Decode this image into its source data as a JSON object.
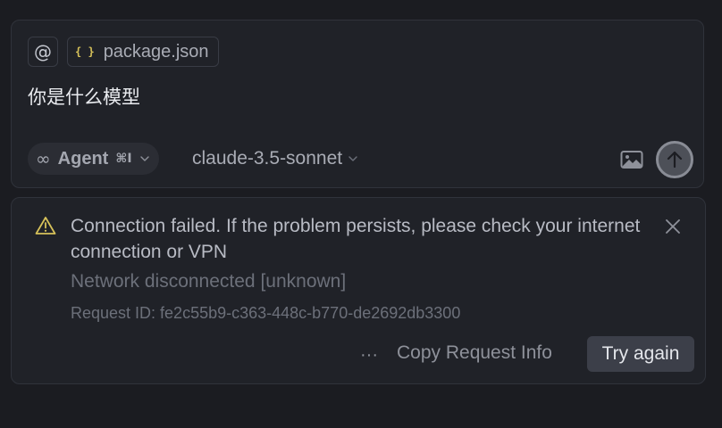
{
  "composer": {
    "mention_symbol": "@",
    "context_file": {
      "icon": "json-braces-icon",
      "icon_glyph": "{ }",
      "name": "package.json"
    },
    "prompt": "你是什么模型",
    "mode": {
      "icon": "infinity-icon",
      "icon_glyph": "∞",
      "label": "Agent",
      "shortcut": "⌘I"
    },
    "model": "claude-3.5-sonnet",
    "image_button_icon": "image-icon",
    "send_button_icon": "arrow-up-icon"
  },
  "error": {
    "icon": "warning-triangle-icon",
    "title": "Connection failed. If the problem persists, please check your internet connection or VPN",
    "detail": "Network disconnected [unknown]",
    "request_id": "Request ID: fe2c55b9-c363-448c-b770-de2692db3300",
    "more_label": "···",
    "copy_label": "Copy Request Info",
    "retry_label": "Try again"
  },
  "colors": {
    "background": "#1b1c21",
    "panel": "#202228",
    "border": "#30333b",
    "warning": "#d7c25a",
    "json_icon": "#d7c25a",
    "retry_button": "#3c3f49"
  }
}
